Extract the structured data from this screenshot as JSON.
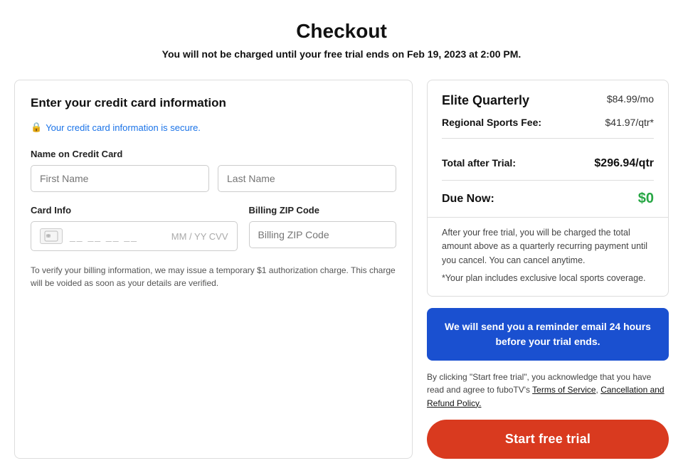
{
  "page": {
    "title": "Checkout",
    "subtitle": "You will not be charged until your free trial ends on Feb 19, 2023 at 2:00 PM."
  },
  "left_panel": {
    "title": "Enter your credit card information",
    "secure_label": "Your credit card information is secure.",
    "name_label": "Name on Credit Card",
    "first_name_placeholder": "First Name",
    "last_name_placeholder": "Last Name",
    "card_info_label": "Card Info",
    "billing_zip_label": "Billing ZIP Code",
    "card_placeholder": "__ __ __ __",
    "card_expiry_cvv": "MM / YY CVV",
    "billing_zip_placeholder": "Billing ZIP Code",
    "verification_note": "To verify your billing information, we may issue a temporary $1 authorization charge. This charge will be voided as soon as your details are verified."
  },
  "right_panel": {
    "plan_name": "Elite Quarterly",
    "plan_price": "$84.99/mo",
    "regional_sports_fee_label": "Regional Sports Fee:",
    "regional_sports_fee_value": "$41.97/qtr*",
    "total_label": "Total after Trial:",
    "total_value": "$296.94/qtr",
    "due_now_label": "Due Now:",
    "due_now_value": "$0",
    "trial_info": "After your free trial, you will be charged the total amount above as a quarterly recurring payment until you cancel. You can cancel anytime.",
    "asterisk_note": "*Your plan includes exclusive local sports coverage.",
    "reminder_text": "We will send you a reminder email 24 hours before your trial ends.",
    "legal_text_before": "By clicking \"Start free trial\", you acknowledge that you have read and agree to fuboTV's ",
    "terms_of_service": "Terms of Service",
    "legal_text_mid": ", ",
    "cancellation_policy": "Cancellation and Refund Policy.",
    "start_trial_label": "Start free trial"
  }
}
